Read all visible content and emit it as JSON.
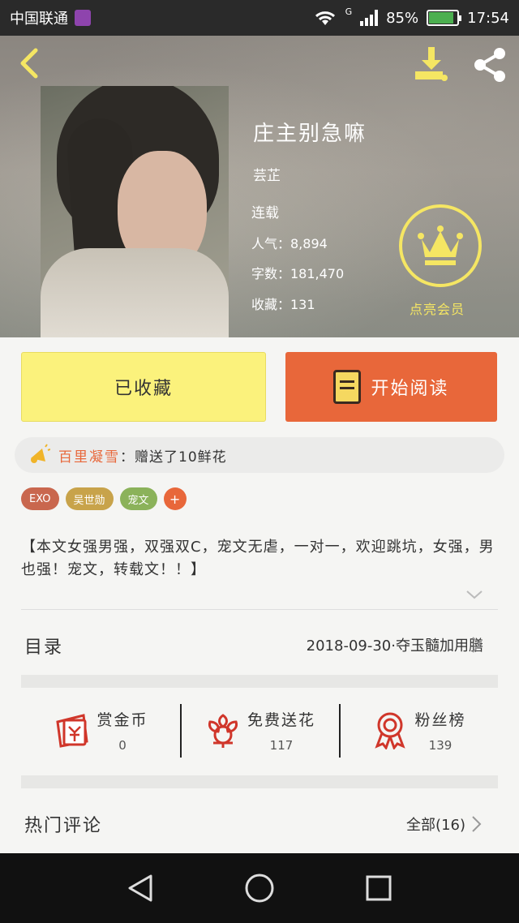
{
  "status_bar": {
    "carrier": "中国联通",
    "network_type": "G",
    "battery_percent": "85%",
    "time": "17:54"
  },
  "book": {
    "title": "庄主别急嘛",
    "author": "芸芷",
    "status": "连载",
    "popularity": "人气：8,894",
    "word_count": "字数：181,470",
    "favorites": "收藏：131"
  },
  "vip": {
    "label": "点亮会员",
    "icon": "crown-icon",
    "color": "#f5e663"
  },
  "actions": {
    "favorited_label": "已收藏",
    "read_label": "开始阅读",
    "favorited_color": "#fbf27c",
    "read_color": "#e8673a"
  },
  "gift_notice": {
    "user": "百里凝雪",
    "text": "：赠送了10鲜花"
  },
  "tags": [
    {
      "label": "EXO",
      "color": "#c9674e"
    },
    {
      "label": "吴世勋",
      "color": "#c8a34a"
    },
    {
      "label": "宠文",
      "color": "#8bb25a"
    }
  ],
  "tag_add_label": "+",
  "description": "【本文女强男强，双强双C，宠文无虐，一对一，欢迎跳坑，女强，男也强！宠文，转载文！！】",
  "catalog": {
    "label": "目录",
    "latest": "2018-09-30·夺玉髓加用膳"
  },
  "stats": [
    {
      "name": "赏金币",
      "count": "0",
      "icon": "reward-coin-icon"
    },
    {
      "name": "免费送花",
      "count": "117",
      "icon": "flower-icon"
    },
    {
      "name": "粉丝榜",
      "count": "139",
      "icon": "ribbon-badge-icon"
    }
  ],
  "comments": {
    "label": "热门评论",
    "all_label": "全部(16)"
  }
}
